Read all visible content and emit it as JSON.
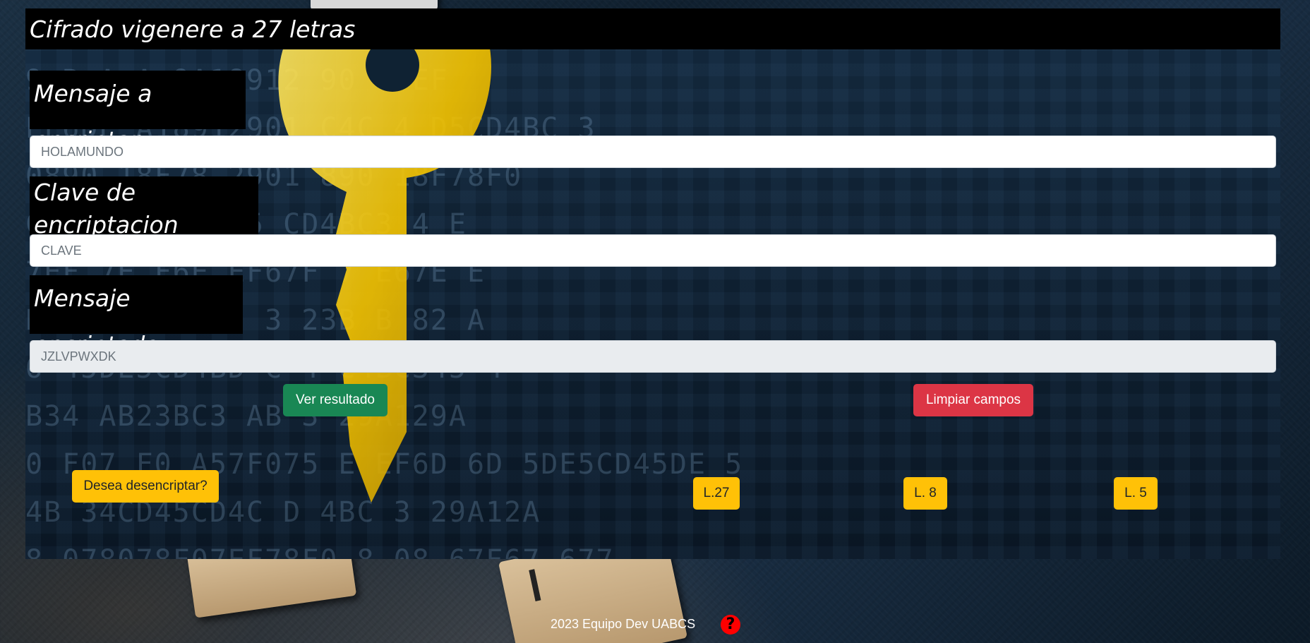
{
  "app": {
    "title": "Cifrado vigenere a 27 letras"
  },
  "form": {
    "message_label": "Mensaje a encriptar",
    "message_value": "HOLAMUNDO",
    "key_label": "Clave de encriptacion",
    "key_value": "CLAVE",
    "result_label": "Mensaje encriptado",
    "result_value": "JZLVPWXDK"
  },
  "actions": {
    "show_result": "Ver resultado",
    "clear_fields": "Limpiar campos",
    "decrypt_prompt": "Desea desencriptar?",
    "mode_27": "L.27",
    "mode_8": "L. 8",
    "mode_5": "L. 5"
  },
  "footer": {
    "text": "2023 Equipo Dev UABCS",
    "help_symbol": "?"
  },
  "colors": {
    "success": "#198754",
    "danger": "#dc3545",
    "warning": "#ffc107",
    "help": "#ff0000"
  },
  "icons": {
    "help": "question-circle-icon"
  }
}
